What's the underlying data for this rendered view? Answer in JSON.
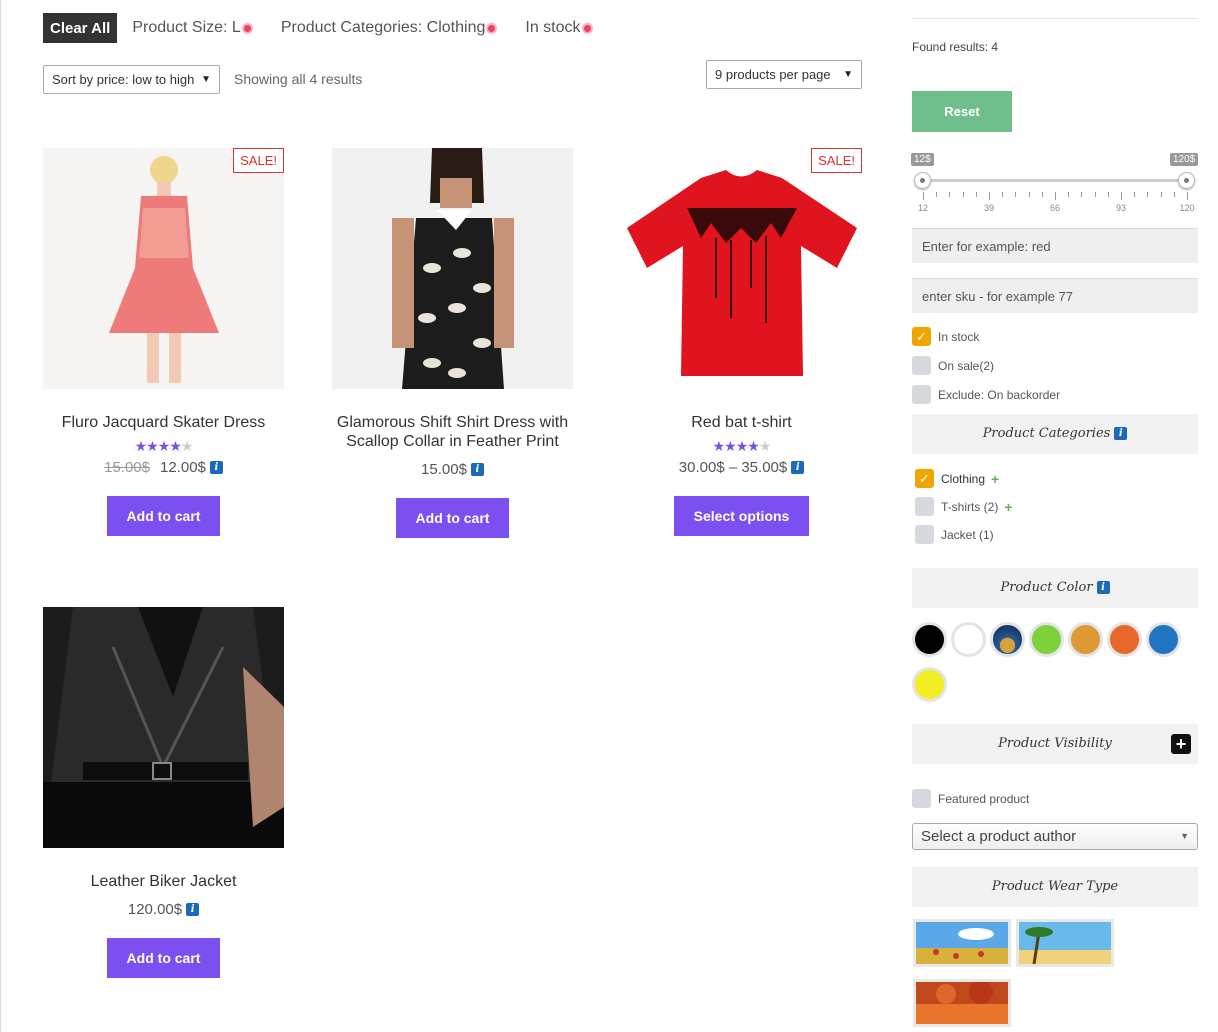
{
  "filters": {
    "clear_all": "Clear All",
    "chips": [
      "Product Size: L",
      "Product Categories: Clothing",
      "In stock"
    ]
  },
  "toolbar": {
    "sort_value": "Sort by price: low to high",
    "showing": "Showing all 4 results",
    "per_page": "9 products per page"
  },
  "products": [
    {
      "title": "Fluro Jacquard Skater Dress",
      "sale_badge": "SALE!",
      "rating": 4,
      "old_price": "15.00$",
      "price": "12.00$",
      "button": "Add to cart"
    },
    {
      "title": "Glamorous Shift Shirt Dress with Scallop Collar in Feather Print",
      "price": "15.00$",
      "button": "Add to cart"
    },
    {
      "title": "Red bat t-shirt",
      "sale_badge": "SALE!",
      "rating": 4,
      "price": "30.00$ – 35.00$",
      "button": "Select options"
    },
    {
      "title": "Leather Biker Jacket",
      "price": "120.00$",
      "button": "Add to cart"
    }
  ],
  "sidebar": {
    "found": "Found results: 4",
    "reset": "Reset",
    "price_slider": {
      "min_label": "12$",
      "max_label": "120$",
      "ticks": [
        "12",
        "39",
        "66",
        "93",
        "120"
      ],
      "min": 12,
      "max": 120
    },
    "color_search_placeholder": "Enter for example: red",
    "sku_placeholder": "enter sku - for example 77",
    "checks": [
      {
        "label": "In stock",
        "checked": true
      },
      {
        "label": "On sale(2)",
        "checked": false
      },
      {
        "label": "Exclude: On backorder",
        "checked": false
      }
    ],
    "categories_title": "Product Categories",
    "categories": [
      {
        "label": "Clothing",
        "checked": true,
        "expand": "+"
      },
      {
        "label": "T-shirts (2)",
        "checked": false,
        "expand": "+"
      },
      {
        "label": "Jacket (1)",
        "checked": false
      }
    ],
    "color_title": "Product Color",
    "colors": [
      "#000000",
      "#ffffff",
      "image",
      "#7dd23b",
      "#dd9a34",
      "#e7682a",
      "#1f75c0",
      "#f2ee22"
    ],
    "visibility_title": "Product Visibility",
    "visibility_toggle": "+",
    "featured": "Featured product",
    "author_select": "Select a product author",
    "wear_title": "Product Wear Type"
  },
  "colors": {
    "accent": "#7b4ff0",
    "reset": "#6ebf8b",
    "checkbox": "#f0a500",
    "sale": "#dd3333",
    "info": "#1a6ab8"
  }
}
